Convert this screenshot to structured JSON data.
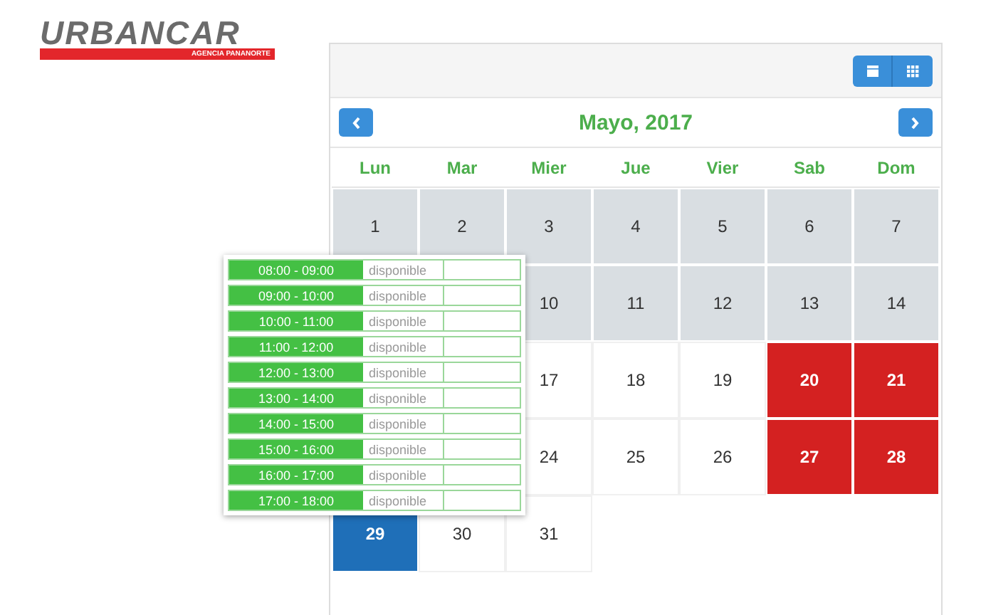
{
  "logo": {
    "name": "URBANCAR",
    "tagline": "AGENCIA PANANORTE"
  },
  "calendar": {
    "title": "Mayo, 2017",
    "weekdays": [
      "Lun",
      "Mar",
      "Mier",
      "Jue",
      "Vier",
      "Sab",
      "Dom"
    ],
    "weeks": [
      {
        "days": [
          {
            "day": "1",
            "kind": "past",
            "selected": false
          },
          {
            "day": "2",
            "kind": "past",
            "selected": false
          },
          {
            "day": "3",
            "kind": "past",
            "selected": false
          },
          {
            "day": "4",
            "kind": "past",
            "selected": false
          },
          {
            "day": "5",
            "kind": "past",
            "selected": false
          },
          {
            "day": "6",
            "kind": "past",
            "selected": false
          },
          {
            "day": "7",
            "kind": "past",
            "selected": false
          }
        ]
      },
      {
        "days": [
          {
            "day": "10",
            "kind": "past",
            "selected": false
          },
          {
            "day": "11",
            "kind": "past",
            "selected": false
          },
          {
            "day": "12",
            "kind": "past",
            "selected": false
          },
          {
            "day": "13",
            "kind": "past",
            "selected": false
          },
          {
            "day": "14",
            "kind": "past",
            "selected": false
          }
        ]
      },
      {
        "days": [
          {
            "day": "17",
            "kind": "open",
            "selected": false
          },
          {
            "day": "18",
            "kind": "open",
            "selected": false
          },
          {
            "day": "19",
            "kind": "open",
            "selected": false
          },
          {
            "day": "20",
            "kind": "booked",
            "selected": false
          },
          {
            "day": "21",
            "kind": "booked",
            "selected": false
          }
        ]
      },
      {
        "days": [
          {
            "day": "24",
            "kind": "open",
            "selected": false
          },
          {
            "day": "25",
            "kind": "open",
            "selected": false
          },
          {
            "day": "26",
            "kind": "open",
            "selected": false
          },
          {
            "day": "27",
            "kind": "booked",
            "selected": false
          },
          {
            "day": "28",
            "kind": "booked",
            "selected": false
          }
        ]
      },
      {
        "days": [
          {
            "day": "29",
            "selected": true
          },
          {
            "day": "30",
            "kind": "open",
            "selected": false
          },
          {
            "day": "31",
            "kind": "open",
            "selected": false
          }
        ]
      }
    ]
  },
  "slots_popup": [
    {
      "time": "08:00 - 09:00",
      "status": "disponible"
    },
    {
      "time": "09:00 - 10:00",
      "status": "disponible"
    },
    {
      "time": "10:00 - 11:00",
      "status": "disponible"
    },
    {
      "time": "11:00 - 12:00",
      "status": "disponible"
    },
    {
      "time": "12:00 - 13:00",
      "status": "disponible"
    },
    {
      "time": "13:00 - 14:00",
      "status": "disponible"
    },
    {
      "time": "14:00 - 15:00",
      "status": "disponible"
    },
    {
      "time": "15:00 - 16:00",
      "status": "disponible"
    },
    {
      "time": "16:00 - 17:00",
      "status": "disponible"
    },
    {
      "time": "17:00 - 18:00",
      "status": "disponible"
    }
  ]
}
